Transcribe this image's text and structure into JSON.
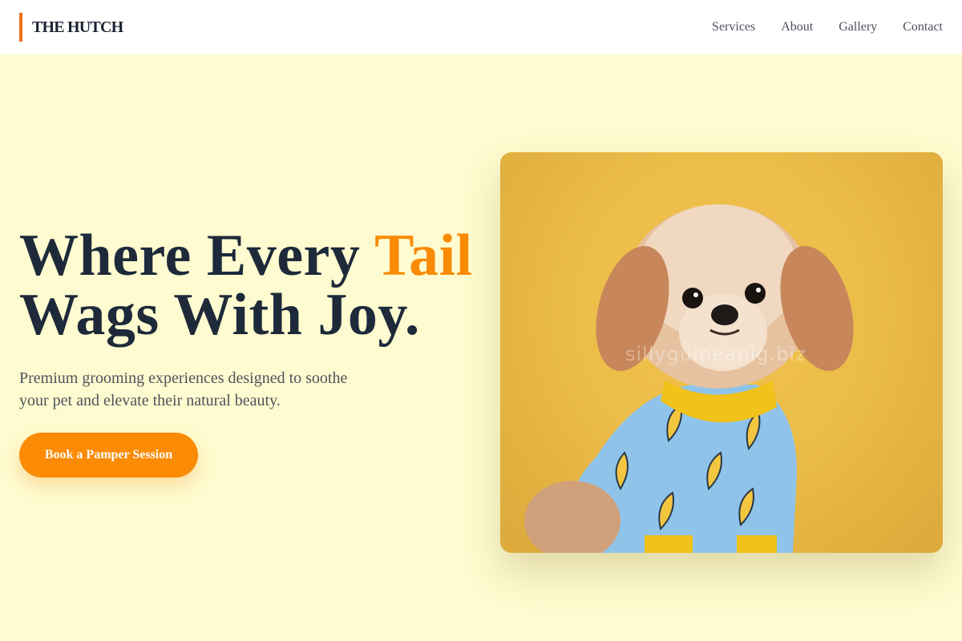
{
  "header": {
    "brand": "THE HUTCH",
    "nav": [
      {
        "label": "Services"
      },
      {
        "label": "About"
      },
      {
        "label": "Gallery"
      },
      {
        "label": "Contact"
      }
    ]
  },
  "hero": {
    "headline_part1": "Where Every ",
    "headline_accent": "Tail",
    "headline_line2": "Wags With Joy.",
    "subhead": "Premium grooming experiences designed to soothe your pet and elevate their natural beauty.",
    "cta_label": "Book a Pamper Session"
  },
  "photo": {
    "subject": "small fluffy dog in blue banana-print pajamas",
    "watermark": "sillyguineapig.biz"
  },
  "colors": {
    "page_bg": "#fefbd0",
    "accent": "#f98b05",
    "brand_bar": "#ee6f1f",
    "heading": "#1e2a3a",
    "photo_bg": "#ebbd49"
  }
}
